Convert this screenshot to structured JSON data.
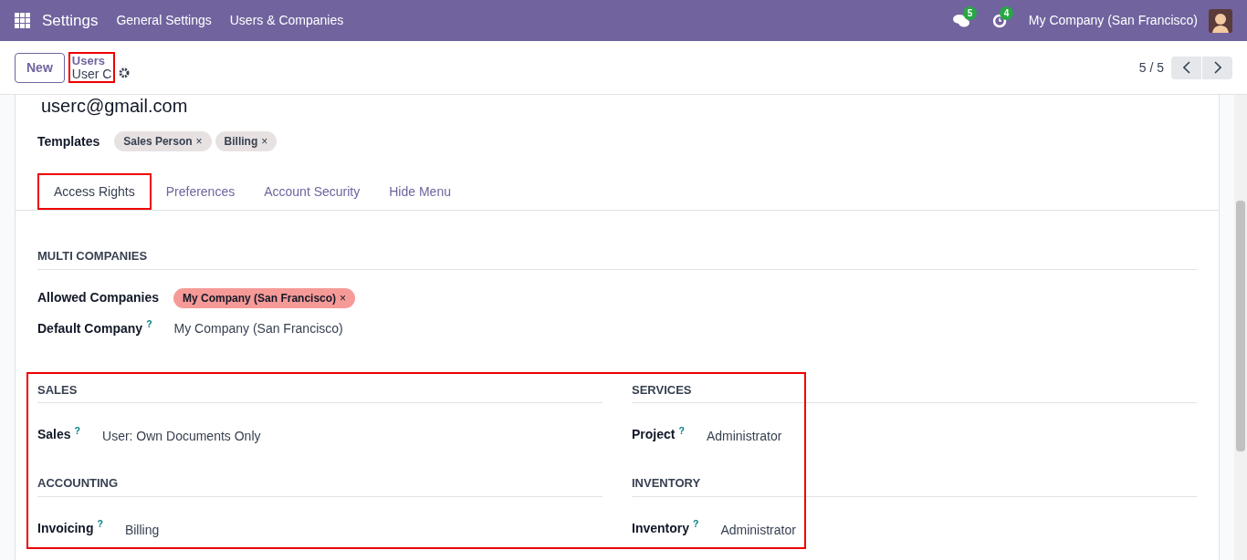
{
  "navbar": {
    "app": "Settings",
    "menu": [
      "General Settings",
      "Users & Companies"
    ],
    "messages_count": "5",
    "activities_count": "4",
    "company": "My Company (San Francisco)"
  },
  "control_panel": {
    "new_button": "New",
    "breadcrumb": "Users",
    "record": "User C",
    "pager": "5 / 5"
  },
  "form": {
    "email": "userc@gmail.com",
    "templates_label": "Templates",
    "templates": [
      {
        "label": "Sales Person",
        "remove": "×"
      },
      {
        "label": "Billing",
        "remove": "×"
      }
    ],
    "tabs": [
      {
        "label": "Access Rights",
        "selected": true
      },
      {
        "label": "Preferences",
        "selected": false
      },
      {
        "label": "Account Security",
        "selected": false
      },
      {
        "label": "Hide Menu",
        "selected": false
      }
    ],
    "multi_companies": {
      "title": "MULTI COMPANIES",
      "allowed_label": "Allowed Companies",
      "allowed": [
        {
          "label": "My Company (San Francisco)",
          "remove": "×"
        }
      ],
      "default_label": "Default Company",
      "help": "?",
      "default_value": "My Company (San Francisco)"
    },
    "columns": [
      {
        "sections": [
          {
            "title": "SALES",
            "label": "Sales",
            "help": "?",
            "value": "User: Own Documents Only"
          },
          {
            "title": "ACCOUNTING",
            "label": "Invoicing",
            "help": "?",
            "value": "Billing"
          }
        ]
      },
      {
        "sections": [
          {
            "title": "SERVICES",
            "label": "Project",
            "help": "?",
            "value": "Administrator"
          },
          {
            "title": "INVENTORY",
            "label": "Inventory",
            "help": "?",
            "value": "Administrator"
          }
        ]
      }
    ]
  }
}
